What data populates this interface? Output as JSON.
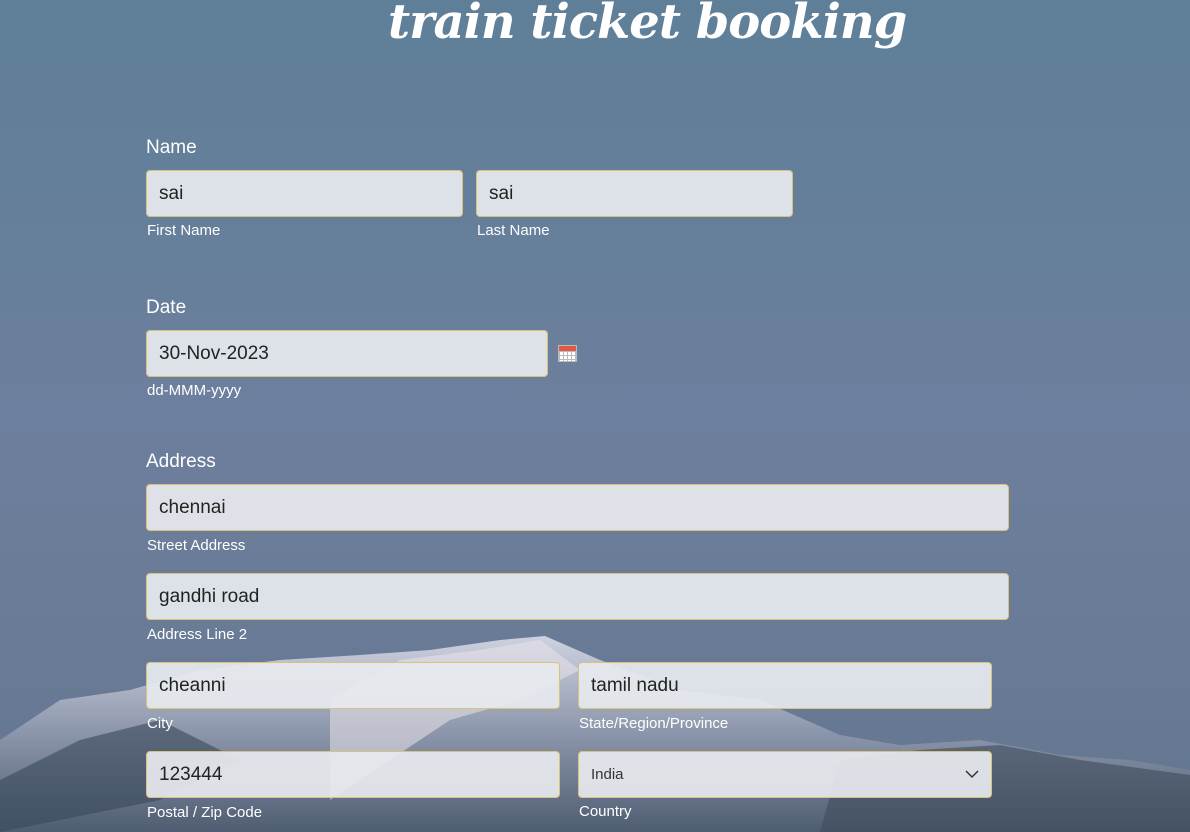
{
  "title": "train ticket booking",
  "name": {
    "label": "Name",
    "first_value": "sai",
    "first_caption": "First Name",
    "last_value": "sai",
    "last_caption": "Last Name"
  },
  "date": {
    "label": "Date",
    "value": "30-Nov-2023",
    "caption": "dd-MMM-yyyy",
    "icon": "calendar-icon"
  },
  "address": {
    "label": "Address",
    "street_value": "chennai",
    "street_caption": "Street Address",
    "line2_value": "gandhi road",
    "line2_caption": "Address Line 2",
    "city_value": "cheanni",
    "city_caption": "City",
    "state_value": "tamil nadu",
    "state_caption": "State/Region/Province",
    "zip_value": "123444",
    "zip_caption": "Postal / Zip Code",
    "country_value": "India",
    "country_caption": "Country"
  }
}
